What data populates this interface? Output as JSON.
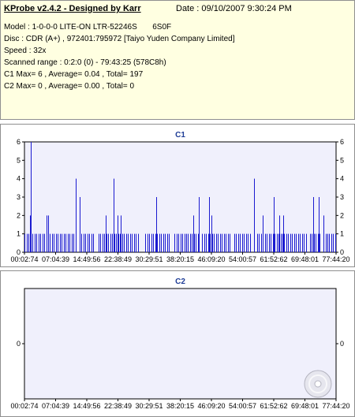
{
  "header": {
    "app_title": "KProbe v2.4.2 - Designed by Karr",
    "date": "Date : 09/10/2007 9:30:24 PM",
    "model": "Model : 1-0-0-0 LITE-ON LTR-52246S       6S0F",
    "disc": "Disc : CDR (A+) , 972401:795972 [Taiyo Yuden Company Limited]",
    "speed": "Speed : 32x",
    "scanned_range": "Scanned range : 0:2:0 (0) - 79:43:25 (578C8h)",
    "c1_stats": "C1 Max= 6 , Average= 0.04 , Total= 197",
    "c2_stats": "C2 Max= 0 , Average= 0.00 , Total= 0"
  },
  "colors": {
    "plot_bg": "#f0f0fc",
    "bar": "#1a1ad0",
    "title": "#1e3c96"
  },
  "chart_data": [
    {
      "type": "bar",
      "title": "C1",
      "ylim": [
        0,
        6
      ],
      "yticks": [
        "0",
        "1",
        "2",
        "3",
        "4",
        "5",
        "6"
      ],
      "xticks": [
        "00:02:74",
        "07:04:39",
        "14:49:56",
        "22:38:49",
        "30:29:51",
        "38:20:15",
        "46:09:20",
        "54:00:57",
        "61:52:62",
        "69:48:01",
        "77:44:20"
      ],
      "x_start_min": 0.0467,
      "x_end_min": 79.72,
      "x_unit": "minutes",
      "grid": true,
      "spikes": [
        {
          "t": 1.6,
          "v": 6
        },
        {
          "t": 1.4,
          "v": 2
        },
        {
          "t": 5.6,
          "v": 2
        },
        {
          "t": 6.0,
          "v": 2
        },
        {
          "t": 13.2,
          "v": 4
        },
        {
          "t": 14.2,
          "v": 3
        },
        {
          "t": 20.8,
          "v": 2
        },
        {
          "t": 22.8,
          "v": 4
        },
        {
          "t": 23.8,
          "v": 2
        },
        {
          "t": 24.6,
          "v": 2
        },
        {
          "t": 33.8,
          "v": 3
        },
        {
          "t": 43.2,
          "v": 2
        },
        {
          "t": 44.6,
          "v": 3
        },
        {
          "t": 47.2,
          "v": 3
        },
        {
          "t": 47.8,
          "v": 2
        },
        {
          "t": 58.8,
          "v": 4
        },
        {
          "t": 61.0,
          "v": 2
        },
        {
          "t": 63.8,
          "v": 3
        },
        {
          "t": 65.2,
          "v": 2
        },
        {
          "t": 66.2,
          "v": 2
        },
        {
          "t": 73.8,
          "v": 3
        },
        {
          "t": 75.2,
          "v": 3
        },
        {
          "t": 76.4,
          "v": 2
        }
      ],
      "ones_ranges": [
        [
          0.1,
          12.9
        ],
        [
          14.6,
          17.8
        ],
        [
          19.0,
          29.3
        ],
        [
          31.0,
          37.2
        ],
        [
          38.4,
          44.5
        ],
        [
          45.5,
          52.5
        ],
        [
          53.7,
          57.9
        ],
        [
          59.5,
          72.1
        ],
        [
          73.0,
          75.6
        ],
        [
          76.5,
          79.6
        ]
      ],
      "ones_density": 0.5
    },
    {
      "type": "bar",
      "title": "C2",
      "ylim": [
        0,
        1
      ],
      "yticks": [
        "0"
      ],
      "xticks": [
        "00:02:74",
        "07:04:39",
        "14:49:56",
        "22:38:49",
        "30:29:51",
        "38:20:15",
        "46:09:20",
        "54:00:57",
        "61:52:62",
        "69:48:01",
        "77:44:20"
      ],
      "spikes": [],
      "grid": false
    }
  ]
}
